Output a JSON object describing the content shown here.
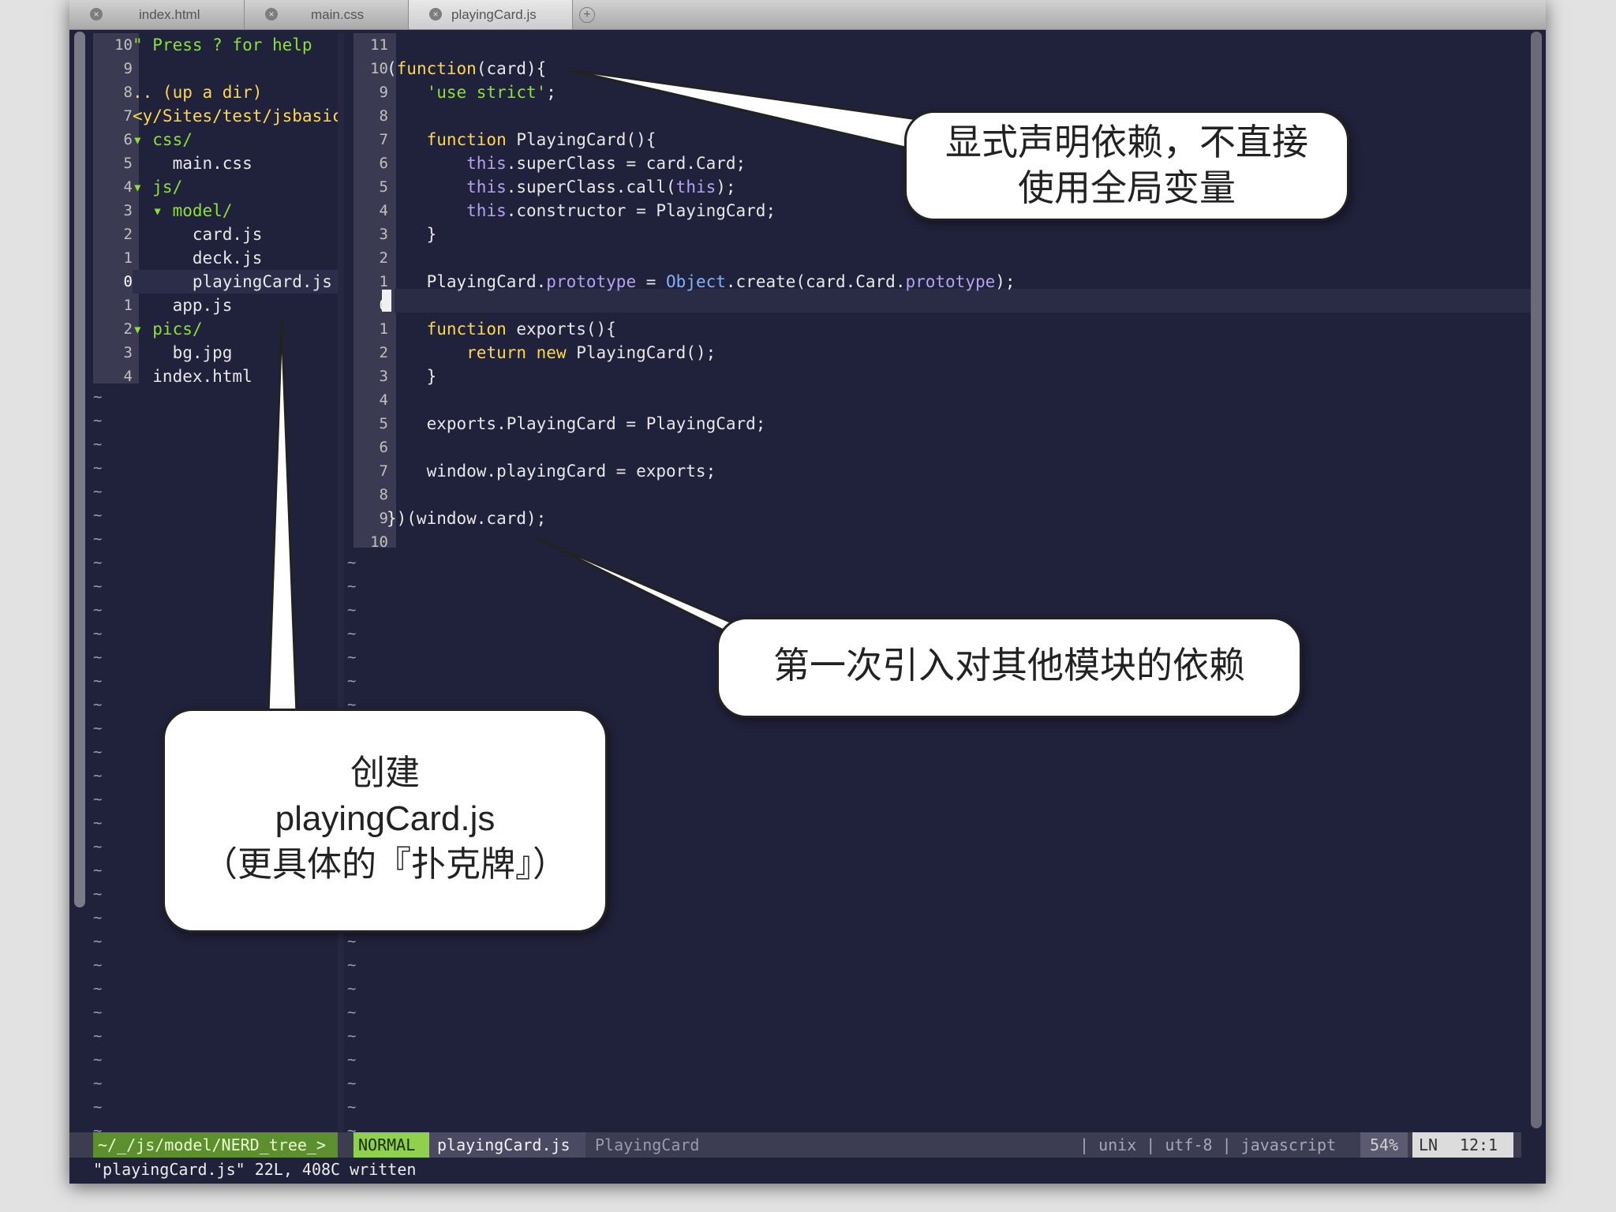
{
  "tabs": [
    {
      "label": "index.html",
      "active": false
    },
    {
      "label": "main.css",
      "active": false
    },
    {
      "label": "playingCard.js",
      "active": true
    }
  ],
  "tree": {
    "rows": [
      {
        "num": "10",
        "text": "\" Press ? for help"
      },
      {
        "num": "9",
        "text": ""
      },
      {
        "num": "8",
        "text": ".. (up a dir)"
      },
      {
        "num": "7",
        "text": "<y/Sites/test/jsbasic"
      },
      {
        "num": "6",
        "text": "▾ css/"
      },
      {
        "num": "5",
        "text": "    main.css"
      },
      {
        "num": "4",
        "text": "▾ js/"
      },
      {
        "num": "3",
        "text": "  ▾ model/"
      },
      {
        "num": "2",
        "text": "      card.js"
      },
      {
        "num": "1",
        "text": "      deck.js"
      },
      {
        "num": "0",
        "text": "      playingCard.js"
      },
      {
        "num": "1",
        "text": "    app.js"
      },
      {
        "num": "2",
        "text": "▾ pics/"
      },
      {
        "num": "3",
        "text": "    bg.jpg"
      },
      {
        "num": "4",
        "text": "  index.html"
      }
    ]
  },
  "code": {
    "rows": [
      {
        "num": "11",
        "text": ""
      },
      {
        "num": "10",
        "text": "(function(card){"
      },
      {
        "num": "9",
        "text": "    'use strict';"
      },
      {
        "num": "8",
        "text": ""
      },
      {
        "num": "7",
        "text": "    function PlayingCard(){"
      },
      {
        "num": "6",
        "text": "        this.superClass = card.Card;"
      },
      {
        "num": "5",
        "text": "        this.superClass.call(this);"
      },
      {
        "num": "4",
        "text": "        this.constructor = PlayingCard;"
      },
      {
        "num": "3",
        "text": "    }"
      },
      {
        "num": "2",
        "text": ""
      },
      {
        "num": "1",
        "text": "    PlayingCard.prototype = Object.create(card.Card.prototype);"
      },
      {
        "num": "0",
        "text": ""
      },
      {
        "num": "1",
        "text": "    function exports(){"
      },
      {
        "num": "2",
        "text": "        return new PlayingCard();"
      },
      {
        "num": "3",
        "text": "    }"
      },
      {
        "num": "4",
        "text": ""
      },
      {
        "num": "5",
        "text": "    exports.PlayingCard = PlayingCard;"
      },
      {
        "num": "6",
        "text": ""
      },
      {
        "num": "7",
        "text": "    window.playingCard = exports;"
      },
      {
        "num": "8",
        "text": ""
      },
      {
        "num": "9",
        "text": "})(window.card);"
      },
      {
        "num": "10",
        "text": ""
      }
    ]
  },
  "statusline": {
    "tree_path": "~/_/js/model/NERD_tree_>",
    "mode": "NORMAL",
    "filename": "playingCard.js",
    "tag": "PlayingCard",
    "fileformat": "| unix | utf-8 | javascript",
    "percent": "54%",
    "ln_label": "LN",
    "position": "12:1"
  },
  "cmdline": "\"playingCard.js\" 22L, 408C written",
  "callouts": {
    "top_line1": "显式声明依赖，不直接",
    "top_line2": "使用全局变量",
    "middle": "第一次引入对其他模块的依赖",
    "bottom_line1": "创建",
    "bottom_line2": "playingCard.js",
    "bottom_line3": "（更具体的『扑克牌』）"
  },
  "colors": {
    "editor_bg": "#20213a",
    "keyword": "#ffd84a",
    "string": "#8ae233",
    "object": "#7fb2ff",
    "property": "#b5a2f3",
    "mode_badge": "#8fd14f"
  }
}
